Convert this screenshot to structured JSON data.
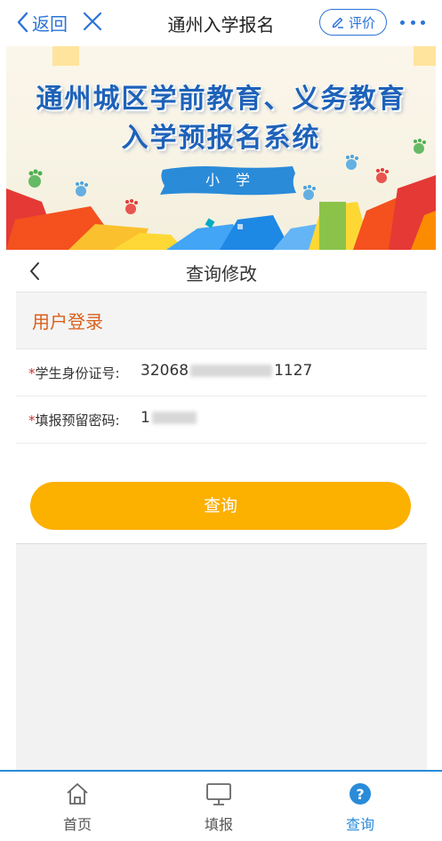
{
  "topbar": {
    "back_label": "返回",
    "title": "通州入学报名",
    "rate_label": "评价"
  },
  "banner": {
    "line1": "通州城区学前教育、义务教育",
    "line2": "入学预报名系统",
    "ribbon": "小学"
  },
  "page": {
    "title": "查询修改"
  },
  "login": {
    "section_title": "用户登录",
    "id_label": "学生身份证号:",
    "id_prefix": "32068",
    "id_suffix": "1127",
    "pwd_label": "填报预留密码:",
    "pwd_prefix": "1"
  },
  "query_button": "查询",
  "tabs": [
    {
      "label": "首页",
      "active": false
    },
    {
      "label": "填报",
      "active": false
    },
    {
      "label": "查询",
      "active": true
    }
  ],
  "colors": {
    "accent": "#2a73d9",
    "button": "#fcb000",
    "section_title": "#d8601c",
    "required": "#d0302a"
  }
}
